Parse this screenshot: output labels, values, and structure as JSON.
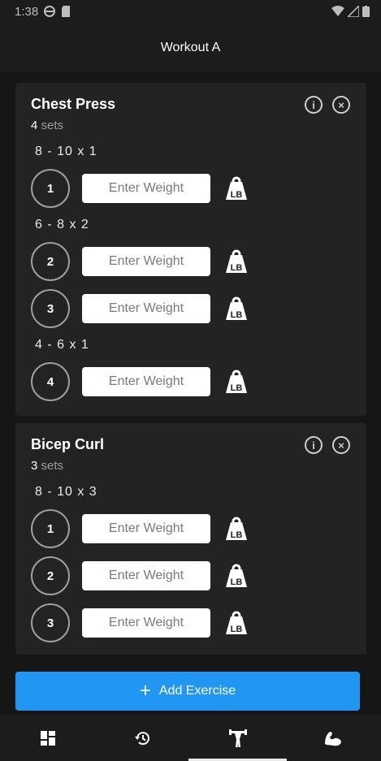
{
  "status_bar": {
    "time": "1:38"
  },
  "header": {
    "title": "Workout A"
  },
  "exercises": [
    {
      "name": "Chest Press",
      "set_count": "4",
      "sets_suffix": "sets",
      "groups": [
        {
          "rep_scheme": "8 - 10 x 1",
          "sets": [
            {
              "number": "1",
              "placeholder": "Enter Weight"
            }
          ]
        },
        {
          "rep_scheme": "6 - 8 x 2",
          "sets": [
            {
              "number": "2",
              "placeholder": "Enter Weight"
            },
            {
              "number": "3",
              "placeholder": "Enter Weight"
            }
          ]
        },
        {
          "rep_scheme": "4 - 6 x 1",
          "sets": [
            {
              "number": "4",
              "placeholder": "Enter Weight"
            }
          ]
        }
      ]
    },
    {
      "name": "Bicep Curl",
      "set_count": "3",
      "sets_suffix": "sets",
      "groups": [
        {
          "rep_scheme": "8 - 10 x 3",
          "sets": [
            {
              "number": "1",
              "placeholder": "Enter Weight"
            },
            {
              "number": "2",
              "placeholder": "Enter Weight"
            },
            {
              "number": "3",
              "placeholder": "Enter Weight"
            }
          ]
        }
      ]
    }
  ],
  "weight_unit_icon": "LB",
  "info_icon": "i",
  "remove_icon": "×",
  "add_exercise": {
    "plus": "+",
    "label": "Add Exercise"
  },
  "bottom_nav": [
    {
      "icon": "dashboard-icon"
    },
    {
      "icon": "history-icon"
    },
    {
      "icon": "workout-icon",
      "active": true
    },
    {
      "icon": "muscle-icon"
    }
  ],
  "colors": {
    "accent": "#2196f3",
    "background": "#161616",
    "card": "#232323"
  }
}
